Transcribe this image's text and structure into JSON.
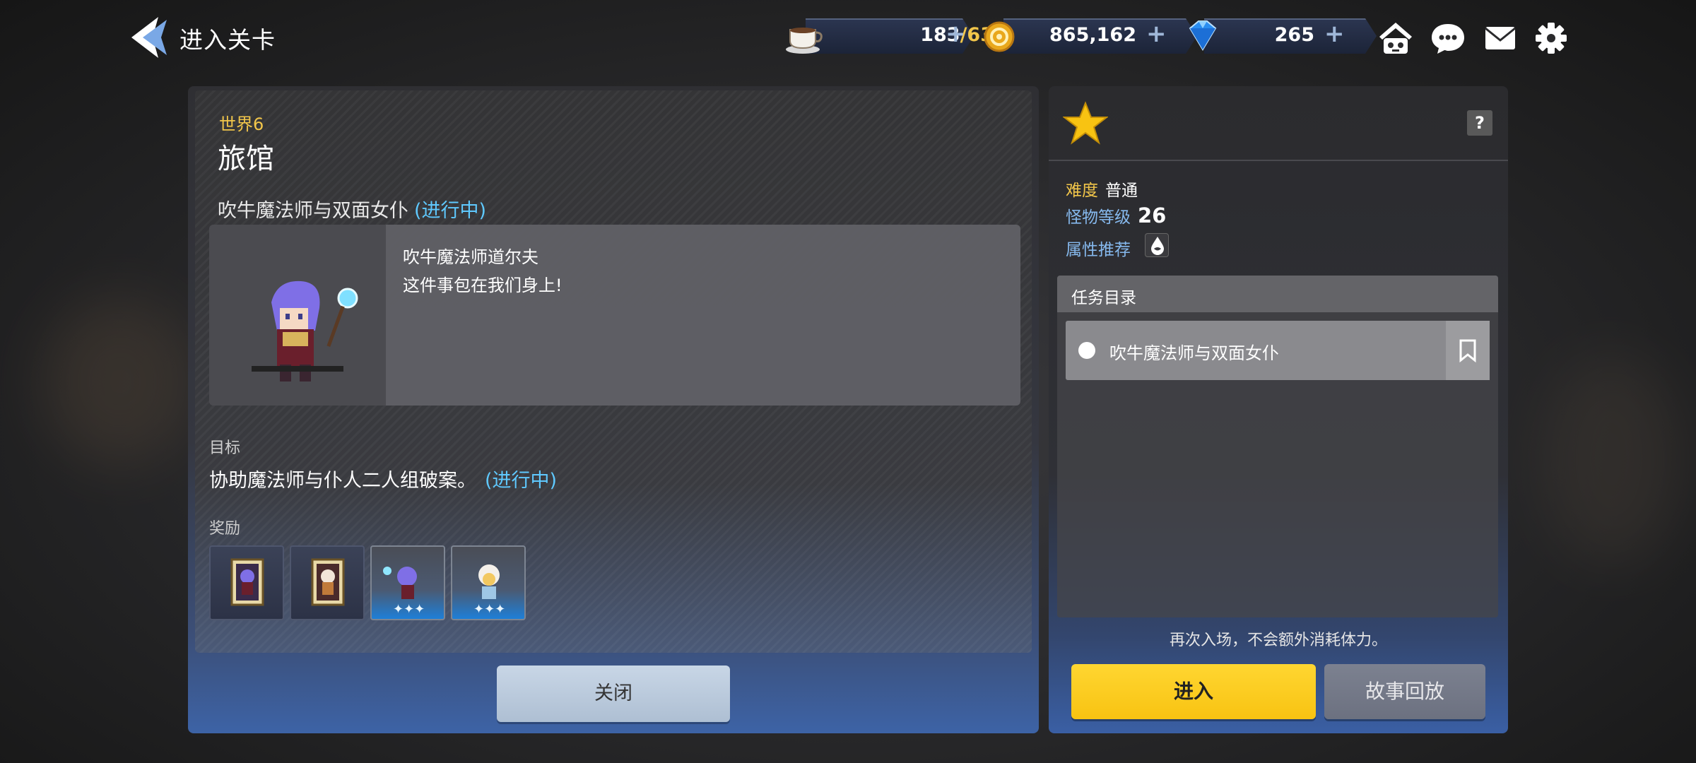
{
  "header": {
    "title": "进入关卡"
  },
  "resources": {
    "stamina": {
      "current": "183",
      "max": "/63",
      "icon": "coffee-cup-icon"
    },
    "gold": {
      "value": "865,162",
      "icon": "gold-coin-icon"
    },
    "gems": {
      "value": "265",
      "icon": "gem-icon"
    },
    "plus": "+"
  },
  "top_icons": [
    "guild-icon",
    "chat-icon",
    "mail-icon",
    "settings-icon"
  ],
  "stage": {
    "world": "世界6",
    "name": "旅馆",
    "quest_title": "吹牛魔法师与双面女仆",
    "quest_status": "(进行中)",
    "dialog": {
      "speaker": "吹牛魔法师道尔夫",
      "line": "这件事包在我们身上!"
    },
    "goal_label": "目标",
    "goal_text": "协助魔法师与仆人二人组破案。",
    "goal_status": "(进行中)",
    "reward_label": "奖励",
    "close_label": "关闭"
  },
  "info": {
    "help": "?",
    "difficulty_label": "难度",
    "difficulty_value": "普通",
    "monster_level_label": "怪物等级",
    "monster_level_value": "26",
    "attribute_label": "属性推荐",
    "task_header": "任务目录",
    "tasks": [
      {
        "name": "吹牛魔法师与双面女仆"
      }
    ],
    "notice": "再次入场，不会额外消耗体力。",
    "enter_label": "进入",
    "replay_label": "故事回放"
  },
  "colors": {
    "accent_yellow": "#f8c312",
    "progress_cyan": "#5fc9ff",
    "label_gold": "#f2c64a",
    "label_blue": "#86b9ee"
  }
}
